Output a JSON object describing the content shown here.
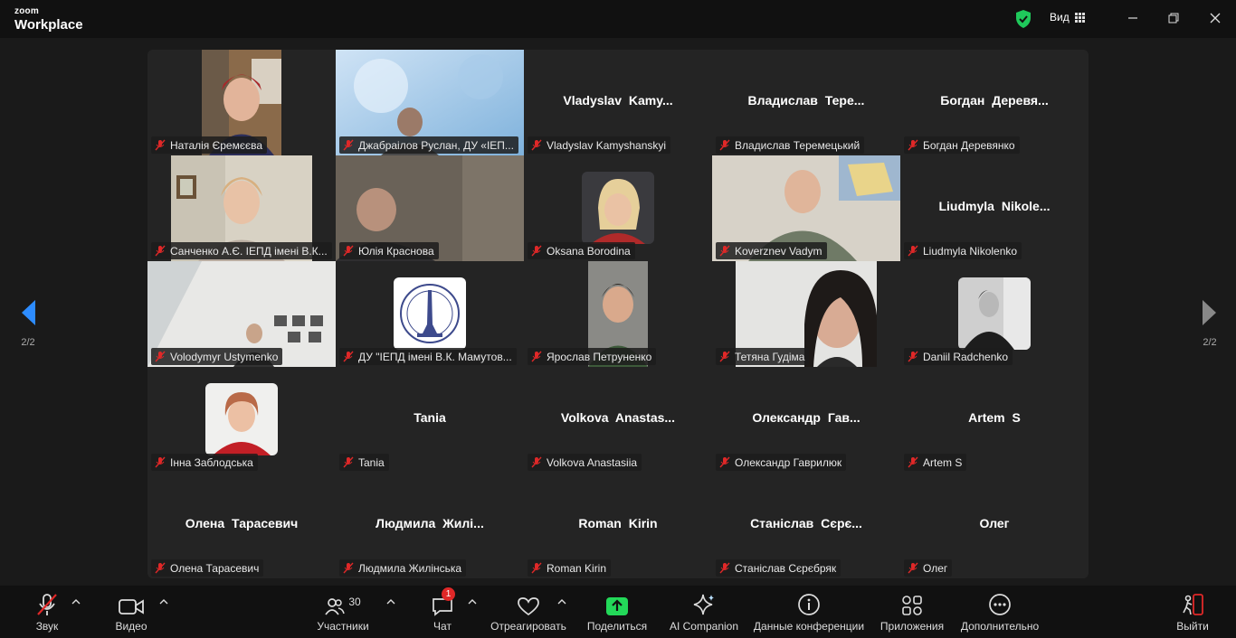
{
  "window": {
    "logo_top": "zoom",
    "logo_bottom": "Workplace",
    "view_label": "Вид"
  },
  "pager": {
    "left": "2/2",
    "right": "2/2"
  },
  "participants": [
    {
      "label": "Наталія Єремєєва",
      "display": ""
    },
    {
      "label": "Джабраілов Руслан, ДУ «ІЕП...",
      "display": ""
    },
    {
      "label": "Vladyslav Kamyshanskyi",
      "display": "Vladyslav  Kamy..."
    },
    {
      "label": "Владислав Теремецький",
      "display": "Владислав  Тере..."
    },
    {
      "label": "Богдан Деревянко",
      "display": "Богдан  Деревя..."
    },
    {
      "label": "Санченко А.Є. ІЕПД імені В.К...",
      "display": ""
    },
    {
      "label": "Юлія Краснова",
      "display": ""
    },
    {
      "label": "Oksana Borodina",
      "display": ""
    },
    {
      "label": "Koverznev Vadym",
      "display": ""
    },
    {
      "label": "Liudmyla Nikolenko",
      "display": "Liudmyla  Nikole..."
    },
    {
      "label": "Volodymyr Ustymenko",
      "display": ""
    },
    {
      "label": "ДУ \"ІЕПД імені В.К. Мамутов...",
      "display": ""
    },
    {
      "label": "Ярослав Петруненко",
      "display": ""
    },
    {
      "label": "Тетяна Гудіма",
      "display": ""
    },
    {
      "label": "Daniil Radchenko",
      "display": ""
    },
    {
      "label": "Інна Заблодська",
      "display": ""
    },
    {
      "label": "Tania",
      "display": "Tania"
    },
    {
      "label": "Volkova Anastasiia",
      "display": "Volkova  Anastas..."
    },
    {
      "label": "Олександр Гаврилюк",
      "display": "Олександр  Гав..."
    },
    {
      "label": "Artem S",
      "display": "Artem S"
    },
    {
      "label": "Олена Тарасевич",
      "display": "Олена Тарасевич"
    },
    {
      "label": "Людмила Жилінська",
      "display": "Людмила  Жилі..."
    },
    {
      "label": "Roman Kirin",
      "display": "Roman Kirin"
    },
    {
      "label": "Станіслав Сєрєбряк",
      "display": "Станіслав  Сєрє..."
    },
    {
      "label": "Олег",
      "display": "Олег"
    }
  ],
  "toolbar": {
    "audio": "Звук",
    "video": "Видео",
    "participants": "Участники",
    "participants_count": "30",
    "chat": "Чат",
    "chat_badge": "1",
    "react": "Отреагировать",
    "share": "Поделиться",
    "ai": "AI Companion",
    "info": "Данные конференции",
    "apps": "Приложения",
    "more": "Дополнительно",
    "leave": "Выйти"
  },
  "colors": {
    "accent_blue": "#2d8cff",
    "share_green": "#23d959",
    "shield_green": "#1fc95b",
    "leave_red": "#e02828",
    "mic_muted_red": "#e02828"
  }
}
